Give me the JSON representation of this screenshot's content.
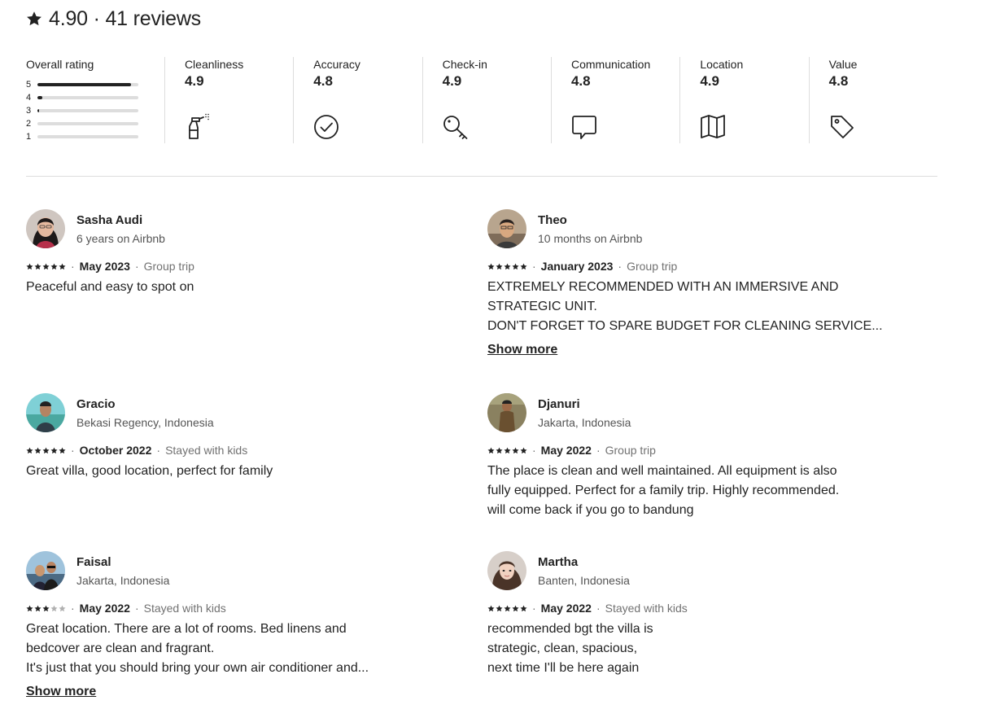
{
  "header": {
    "title": "4.90 · 41 reviews",
    "star_icon": "star-icon"
  },
  "overall": {
    "label": "Overall rating",
    "bars": [
      {
        "label": "5",
        "fraction": 0.93
      },
      {
        "label": "4",
        "fraction": 0.05
      },
      {
        "label": "3",
        "fraction": 0.02
      },
      {
        "label": "2",
        "fraction": 0
      },
      {
        "label": "1",
        "fraction": 0
      }
    ]
  },
  "categories": [
    {
      "title": "Cleanliness",
      "value": "4.9",
      "icon": "spray-bottle-icon"
    },
    {
      "title": "Accuracy",
      "value": "4.8",
      "icon": "check-circle-icon"
    },
    {
      "title": "Check-in",
      "value": "4.9",
      "icon": "key-icon"
    },
    {
      "title": "Communication",
      "value": "4.8",
      "icon": "chat-bubble-icon"
    },
    {
      "title": "Location",
      "value": "4.9",
      "icon": "map-icon"
    },
    {
      "title": "Value",
      "value": "4.8",
      "icon": "price-tag-icon"
    }
  ],
  "reviews": [
    {
      "name": "Sasha Audi",
      "sub": "6 years on Airbnb",
      "rating": 5,
      "date": "May 2023",
      "trip": "Group trip",
      "lines": [
        "Peaceful and easy to spot on"
      ],
      "show_more": ""
    },
    {
      "name": "Theo",
      "sub": "10 months on Airbnb",
      "rating": 5,
      "date": "January 2023",
      "trip": "Group trip",
      "lines": [
        "EXTREMELY RECOMMENDED WITH AN IMMERSIVE AND",
        "STRATEGIC UNIT.",
        "DON'T FORGET TO SPARE BUDGET FOR CLEANING SERVICE..."
      ],
      "show_more": "Show more"
    },
    {
      "name": "Gracio",
      "sub": "Bekasi Regency, Indonesia",
      "rating": 5,
      "date": "October 2022",
      "trip": "Stayed with kids",
      "lines": [
        "Great villa, good location, perfect for family"
      ],
      "show_more": ""
    },
    {
      "name": "Djanuri",
      "sub": "Jakarta, Indonesia",
      "rating": 5,
      "date": "May 2022",
      "trip": "Group trip",
      "lines": [
        "The place is clean and well maintained. All equipment is also",
        "fully equipped. Perfect for a family trip. Highly recommended.",
        "will come back if you go to bandung"
      ],
      "show_more": ""
    },
    {
      "name": "Faisal",
      "sub": "Jakarta, Indonesia",
      "rating": 3,
      "date": "May 2022",
      "trip": "Stayed with kids",
      "lines": [
        "Great location. There are a lot of rooms. Bed linens and",
        "bedcover are clean and fragrant.",
        "It's just that you should bring your own air conditioner and..."
      ],
      "show_more": "Show more"
    },
    {
      "name": "Martha",
      "sub": "Banten, Indonesia",
      "rating": 5,
      "date": "May 2022",
      "trip": "Stayed with kids",
      "lines": [
        "recommended bgt the villa is",
        "strategic, clean, spacious,",
        "next time I'll be here again"
      ],
      "show_more": ""
    }
  ],
  "colors": {
    "text": "#222222",
    "muted": "#717171",
    "track": "#dddddd",
    "star_empty": "#b0b0b0"
  }
}
